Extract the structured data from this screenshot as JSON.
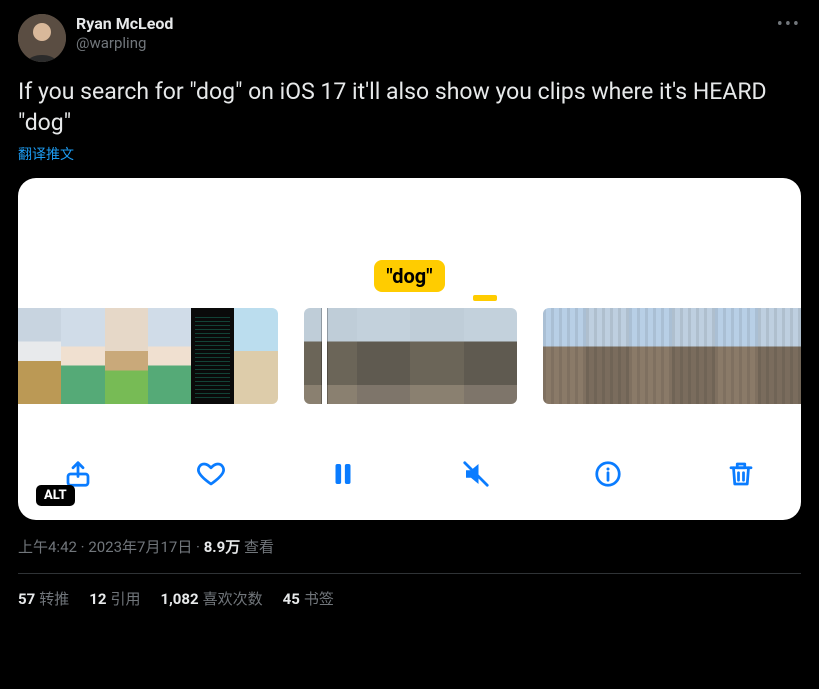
{
  "author": {
    "display_name": "Ryan McLeod",
    "handle": "@warpling"
  },
  "more_icon": "more-icon",
  "tweet_text": "If you search for \"dog\" on iOS 17 it'll also show you clips where it's HEARD \"dog\"",
  "translate_label": "翻译推文",
  "media": {
    "keyword_label": "\"dog\"",
    "alt_badge": "ALT",
    "toolbar": {
      "share": "share-icon",
      "like": "heart-icon",
      "pause": "pause-icon",
      "mute": "speaker-muted-icon",
      "info": "info-icon",
      "trash": "trash-icon"
    }
  },
  "meta": {
    "time": "上午4:42",
    "date": "2023年7月17日",
    "views_count": "8.9万",
    "views_label": "查看"
  },
  "stats": {
    "retweets": {
      "count": "57",
      "label": "转推"
    },
    "quotes": {
      "count": "12",
      "label": "引用"
    },
    "likes": {
      "count": "1,082",
      "label": "喜欢次数"
    },
    "bookmarks": {
      "count": "45",
      "label": "书签"
    }
  }
}
